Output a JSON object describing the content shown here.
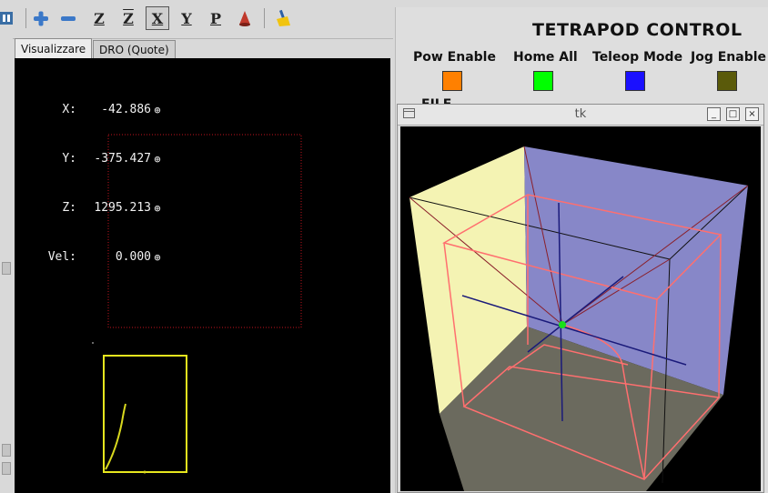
{
  "toolbar": {
    "icons": [
      "machine-icon",
      "zoom-in-icon",
      "zoom-out-icon",
      "view-z-icon",
      "view-z-rotated-icon",
      "view-x-icon",
      "view-y-icon",
      "view-p-icon",
      "clear-live-plot-icon"
    ],
    "z_label": "Z",
    "z2_label": "Z",
    "x_label": "X",
    "y_label": "Y",
    "p_label": "P"
  },
  "tabs": [
    {
      "label": "Visualizzare",
      "active": true
    },
    {
      "label": "DRO (Quote)",
      "active": false
    }
  ],
  "dro": [
    {
      "label": "X:",
      "value": "-42.886"
    },
    {
      "label": "Y:",
      "value": "-375.427"
    },
    {
      "label": "Z:",
      "value": "1295.213"
    },
    {
      "label": "Vel:",
      "value": "0.000"
    }
  ],
  "panel": {
    "title": "TETRAPOD CONTROL",
    "controls": [
      {
        "label": "Pow Enable",
        "color": "#ff8000"
      },
      {
        "label": "Home All",
        "color": "#00ff00"
      },
      {
        "label": "Teleop Mode",
        "color": "#1a10ff"
      },
      {
        "label": "Jog Enable",
        "color": "#5a5a0a"
      }
    ],
    "file_label": "FILE"
  },
  "tk_window": {
    "title": "tk",
    "minimize": "_",
    "maximize": "□",
    "close": "×"
  }
}
